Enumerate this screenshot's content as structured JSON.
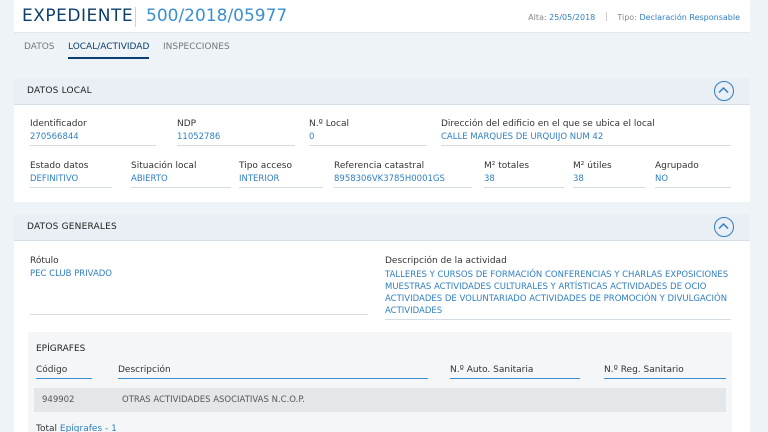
{
  "header": {
    "title": "EXPEDIENTE",
    "number": "500/2018/05977",
    "alta_label": "Alta:",
    "alta_value": "25/05/2018",
    "tipo_label": "Tipo:",
    "tipo_value": "Declaración Responsable"
  },
  "tabs": [
    {
      "label": "DATOS",
      "active": false
    },
    {
      "label": "LOCAL/ACTIVIDAD",
      "active": true
    },
    {
      "label": "INSPECCIONES",
      "active": false
    }
  ],
  "datos_local": {
    "title": "DATOS LOCAL",
    "identificador": {
      "label": "Identificador",
      "value": "270566844"
    },
    "ndp": {
      "label": "NDP",
      "value": "11052786"
    },
    "n_local": {
      "label": "N.º Local",
      "value": "0"
    },
    "direccion": {
      "label": "Dirección del edificio en el que se ubica el local",
      "value": "CALLE MARQUES DE URQUIJO NUM 42"
    },
    "estado": {
      "label": "Estado datos",
      "value": "DEFINITIVO"
    },
    "situacion": {
      "label": "Situación local",
      "value": "ABIERTO"
    },
    "tipo_acceso": {
      "label": "Tipo acceso",
      "value": "INTERIOR"
    },
    "referencia": {
      "label": "Referencia catastral",
      "value": "8958306VK3785H0001GS"
    },
    "m2_totales": {
      "label": "M² totales",
      "value": "38"
    },
    "m2_utiles": {
      "label": "M² útiles",
      "value": "38"
    },
    "agrupado": {
      "label": "Agrupado",
      "value": "NO"
    }
  },
  "datos_generales": {
    "title": "DATOS GENERALES",
    "rotulo": {
      "label": "Rótulo",
      "value": "PEC CLUB PRIVADO"
    },
    "descripcion": {
      "label": "Descripción de la actividad",
      "lines": [
        "TALLERES Y CURSOS DE FORMACIÓN CONFERENCIAS Y CHARLAS EXPOSICIONES",
        "MUESTRAS ACTIVIDADES CULTURALES Y ARTÍSTICAS ACTIVIDADES DE OCIO",
        "ACTIVIDADES DE VOLUNTARIADO ACTIVIDADES DE PROMOCIÓN Y DIVULGACIÓN",
        "ACTIVIDADES"
      ]
    },
    "epigrafes": {
      "title": "EPÍGRAFES",
      "columns": [
        "Código",
        "Descripción",
        "N.º Auto. Sanitaria",
        "N.º Reg. Sanitario"
      ],
      "rows": [
        {
          "codigo": "949902",
          "descripcion": "OTRAS ACTIVIDADES ASOCIATIVAS N.C.O.P.",
          "auto": "",
          "reg": ""
        }
      ],
      "total_label": "Total",
      "total_link": "Epígrafes - 1"
    }
  },
  "colors": {
    "accent": "#2f7fc1",
    "title": "#0b3f6e"
  }
}
